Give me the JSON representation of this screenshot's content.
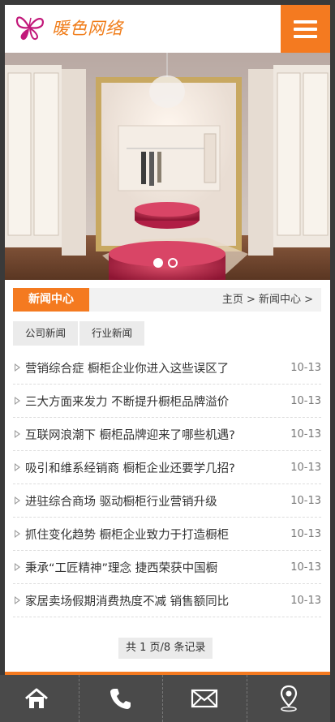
{
  "header": {
    "logo_text": "暖色网络",
    "logo_icon": "butterfly-logo-icon",
    "menu_icon": "hamburger-menu-icon"
  },
  "banner": {
    "slide_count": 2,
    "active_slide": 1
  },
  "news_center": {
    "title": "新闻中心",
    "breadcrumb": "主页 > 新闻中心 >",
    "tabs": [
      {
        "label": "公司新闻"
      },
      {
        "label": "行业新闻"
      }
    ],
    "items": [
      {
        "title": "营销综合症 橱柜企业你进入这些误区了",
        "date": "10-13"
      },
      {
        "title": "三大方面来发力 不断提升橱柜品牌溢价",
        "date": "10-13"
      },
      {
        "title": "互联网浪潮下 橱柜品牌迎来了哪些机遇?",
        "date": "10-13"
      },
      {
        "title": "吸引和维系经销商 橱柜企业还要学几招?",
        "date": "10-13"
      },
      {
        "title": "进驻综合商场 驱动橱柜行业营销升级",
        "date": "10-13"
      },
      {
        "title": "抓住变化趋势 橱柜企业致力于打造橱柜",
        "date": "10-13"
      },
      {
        "title": "秉承“工匠精神”理念 捷西荣获中国橱",
        "date": "10-13"
      },
      {
        "title": "家居卖场假期消费热度不减 销售额同比",
        "date": "10-13"
      }
    ],
    "pager": "共 1 页/8 条记录"
  },
  "footer": {
    "buttons": [
      {
        "icon": "home-icon"
      },
      {
        "icon": "phone-icon"
      },
      {
        "icon": "mail-icon"
      },
      {
        "icon": "location-pin-icon"
      }
    ]
  },
  "colors": {
    "accent": "#f47a20",
    "footer_bg": "#4a4a4a",
    "page_bg": "#3a3a3a"
  }
}
